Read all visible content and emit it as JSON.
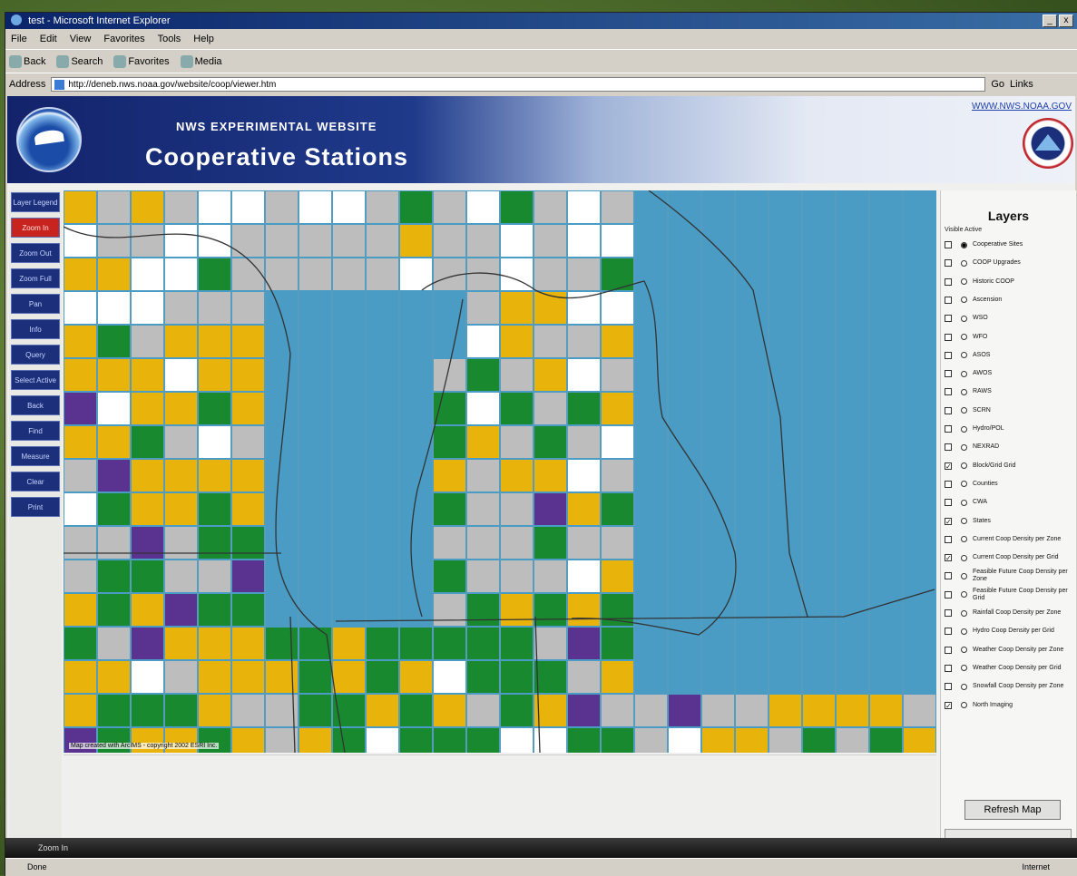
{
  "window": {
    "title": "test - Microsoft Internet Explorer",
    "min": "_",
    "close": "x"
  },
  "menubar": [
    "File",
    "Edit",
    "View",
    "Favorites",
    "Tools",
    "Help"
  ],
  "toolbar": [
    "Back",
    "Search",
    "Favorites",
    "Media"
  ],
  "address": {
    "label": "Address",
    "url": "http://deneb.nws.noaa.gov/website/coop/viewer.htm",
    "go": "Go",
    "links": "Links"
  },
  "banner": {
    "subtitle": "NWS EXPERIMENTAL WEBSITE",
    "title": "Cooperative Stations",
    "link": "WWW.NWS.NOAA.GOV",
    "logo": "NOAA"
  },
  "sidebar": [
    {
      "label": "Layer Legend",
      "active": false
    },
    {
      "label": "Zoom In",
      "active": true
    },
    {
      "label": "Zoom Out",
      "active": false
    },
    {
      "label": "Zoom Full",
      "active": false
    },
    {
      "label": "Pan",
      "active": false
    },
    {
      "label": "Info",
      "active": false
    },
    {
      "label": "Query",
      "active": false
    },
    {
      "label": "Select Active",
      "active": false
    },
    {
      "label": "Back",
      "active": false
    },
    {
      "label": "Find",
      "active": false
    },
    {
      "label": "Measure",
      "active": false
    },
    {
      "label": "Clear",
      "active": false
    },
    {
      "label": "Print",
      "active": false
    }
  ],
  "map": {
    "credit": "Map created with ArcIMS - copyright 2002 ESRI Inc.",
    "colors": {
      "water": "#4a9cc4",
      "green": "#18892f",
      "yellow": "#e8b40c",
      "gray": "#bdbdbd",
      "white": "#ffffff",
      "purple": "#5a3290",
      "line": "#333333"
    }
  },
  "layers": {
    "title": "Layers",
    "header": "Visible Active",
    "items": [
      {
        "label": "Cooperative Sites",
        "checked": false,
        "active": true
      },
      {
        "label": "COOP Upgrades",
        "checked": false,
        "active": false
      },
      {
        "label": "Historic COOP",
        "checked": false,
        "active": false
      },
      {
        "label": "Ascension",
        "checked": false,
        "active": false
      },
      {
        "label": "WSO",
        "checked": false,
        "active": false
      },
      {
        "label": "WFO",
        "checked": false,
        "active": false
      },
      {
        "label": "ASOS",
        "checked": false,
        "active": false
      },
      {
        "label": "AWOS",
        "checked": false,
        "active": false
      },
      {
        "label": "RAWS",
        "checked": false,
        "active": false
      },
      {
        "label": "SCRN",
        "checked": false,
        "active": false
      },
      {
        "label": "Hydro/POL",
        "checked": false,
        "active": false
      },
      {
        "label": "NEXRAD",
        "checked": false,
        "active": false
      },
      {
        "label": "Block/Grid Grid",
        "checked": true,
        "active": false
      },
      {
        "label": "Counties",
        "checked": false,
        "active": false
      },
      {
        "label": "CWA",
        "checked": false,
        "active": false
      },
      {
        "label": "States",
        "checked": true,
        "active": false
      },
      {
        "label": "Current Coop Density per Zone",
        "checked": false,
        "active": false
      },
      {
        "label": "Current Coop Density per Grid",
        "checked": true,
        "active": false
      },
      {
        "label": "Feasible Future Coop Density per Zone",
        "checked": false,
        "active": false
      },
      {
        "label": "Feasible Future Coop Density per Grid",
        "checked": false,
        "active": false
      },
      {
        "label": "Rainfall Coop Density per Zone",
        "checked": false,
        "active": false
      },
      {
        "label": "Hydro Coop Density per Grid",
        "checked": false,
        "active": false
      },
      {
        "label": "Weather Coop Density per Zone",
        "checked": false,
        "active": false
      },
      {
        "label": "Weather Coop Density per Grid",
        "checked": false,
        "active": false
      },
      {
        "label": "Snowfall Coop Density per Zone",
        "checked": false,
        "active": false
      },
      {
        "label": "North Imaging",
        "checked": true,
        "active": false
      }
    ],
    "refresh": "Refresh Map"
  },
  "statusbar": {
    "pane": "Zoom In",
    "text": "Done",
    "zone": "Internet"
  }
}
